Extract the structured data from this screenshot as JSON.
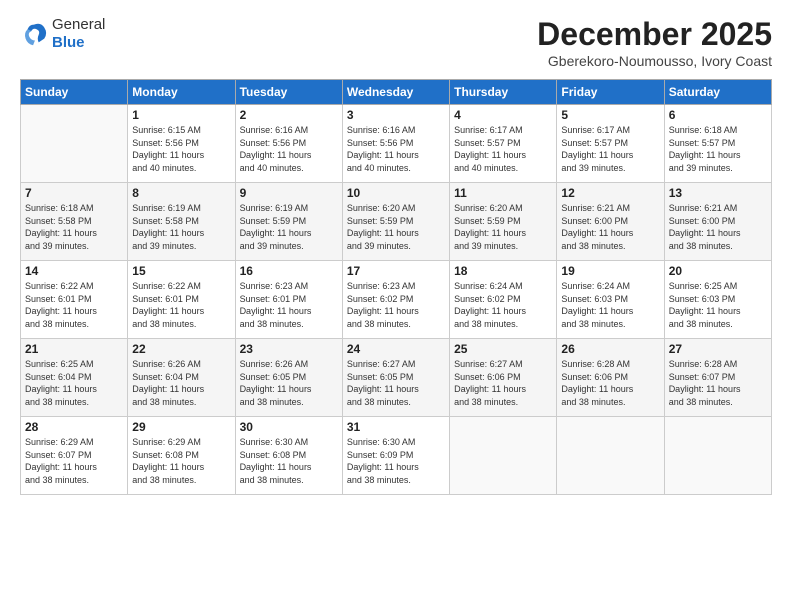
{
  "header": {
    "logo_general": "General",
    "logo_blue": "Blue",
    "month_year": "December 2025",
    "location": "Gberekoro-Noumousso, Ivory Coast"
  },
  "days_of_week": [
    "Sunday",
    "Monday",
    "Tuesday",
    "Wednesday",
    "Thursday",
    "Friday",
    "Saturday"
  ],
  "weeks": [
    [
      {
        "day": "",
        "info": ""
      },
      {
        "day": "1",
        "info": "Sunrise: 6:15 AM\nSunset: 5:56 PM\nDaylight: 11 hours\nand 40 minutes."
      },
      {
        "day": "2",
        "info": "Sunrise: 6:16 AM\nSunset: 5:56 PM\nDaylight: 11 hours\nand 40 minutes."
      },
      {
        "day": "3",
        "info": "Sunrise: 6:16 AM\nSunset: 5:56 PM\nDaylight: 11 hours\nand 40 minutes."
      },
      {
        "day": "4",
        "info": "Sunrise: 6:17 AM\nSunset: 5:57 PM\nDaylight: 11 hours\nand 40 minutes."
      },
      {
        "day": "5",
        "info": "Sunrise: 6:17 AM\nSunset: 5:57 PM\nDaylight: 11 hours\nand 39 minutes."
      },
      {
        "day": "6",
        "info": "Sunrise: 6:18 AM\nSunset: 5:57 PM\nDaylight: 11 hours\nand 39 minutes."
      }
    ],
    [
      {
        "day": "7",
        "info": "Sunrise: 6:18 AM\nSunset: 5:58 PM\nDaylight: 11 hours\nand 39 minutes."
      },
      {
        "day": "8",
        "info": "Sunrise: 6:19 AM\nSunset: 5:58 PM\nDaylight: 11 hours\nand 39 minutes."
      },
      {
        "day": "9",
        "info": "Sunrise: 6:19 AM\nSunset: 5:59 PM\nDaylight: 11 hours\nand 39 minutes."
      },
      {
        "day": "10",
        "info": "Sunrise: 6:20 AM\nSunset: 5:59 PM\nDaylight: 11 hours\nand 39 minutes."
      },
      {
        "day": "11",
        "info": "Sunrise: 6:20 AM\nSunset: 5:59 PM\nDaylight: 11 hours\nand 39 minutes."
      },
      {
        "day": "12",
        "info": "Sunrise: 6:21 AM\nSunset: 6:00 PM\nDaylight: 11 hours\nand 38 minutes."
      },
      {
        "day": "13",
        "info": "Sunrise: 6:21 AM\nSunset: 6:00 PM\nDaylight: 11 hours\nand 38 minutes."
      }
    ],
    [
      {
        "day": "14",
        "info": "Sunrise: 6:22 AM\nSunset: 6:01 PM\nDaylight: 11 hours\nand 38 minutes."
      },
      {
        "day": "15",
        "info": "Sunrise: 6:22 AM\nSunset: 6:01 PM\nDaylight: 11 hours\nand 38 minutes."
      },
      {
        "day": "16",
        "info": "Sunrise: 6:23 AM\nSunset: 6:01 PM\nDaylight: 11 hours\nand 38 minutes."
      },
      {
        "day": "17",
        "info": "Sunrise: 6:23 AM\nSunset: 6:02 PM\nDaylight: 11 hours\nand 38 minutes."
      },
      {
        "day": "18",
        "info": "Sunrise: 6:24 AM\nSunset: 6:02 PM\nDaylight: 11 hours\nand 38 minutes."
      },
      {
        "day": "19",
        "info": "Sunrise: 6:24 AM\nSunset: 6:03 PM\nDaylight: 11 hours\nand 38 minutes."
      },
      {
        "day": "20",
        "info": "Sunrise: 6:25 AM\nSunset: 6:03 PM\nDaylight: 11 hours\nand 38 minutes."
      }
    ],
    [
      {
        "day": "21",
        "info": "Sunrise: 6:25 AM\nSunset: 6:04 PM\nDaylight: 11 hours\nand 38 minutes."
      },
      {
        "day": "22",
        "info": "Sunrise: 6:26 AM\nSunset: 6:04 PM\nDaylight: 11 hours\nand 38 minutes."
      },
      {
        "day": "23",
        "info": "Sunrise: 6:26 AM\nSunset: 6:05 PM\nDaylight: 11 hours\nand 38 minutes."
      },
      {
        "day": "24",
        "info": "Sunrise: 6:27 AM\nSunset: 6:05 PM\nDaylight: 11 hours\nand 38 minutes."
      },
      {
        "day": "25",
        "info": "Sunrise: 6:27 AM\nSunset: 6:06 PM\nDaylight: 11 hours\nand 38 minutes."
      },
      {
        "day": "26",
        "info": "Sunrise: 6:28 AM\nSunset: 6:06 PM\nDaylight: 11 hours\nand 38 minutes."
      },
      {
        "day": "27",
        "info": "Sunrise: 6:28 AM\nSunset: 6:07 PM\nDaylight: 11 hours\nand 38 minutes."
      }
    ],
    [
      {
        "day": "28",
        "info": "Sunrise: 6:29 AM\nSunset: 6:07 PM\nDaylight: 11 hours\nand 38 minutes."
      },
      {
        "day": "29",
        "info": "Sunrise: 6:29 AM\nSunset: 6:08 PM\nDaylight: 11 hours\nand 38 minutes."
      },
      {
        "day": "30",
        "info": "Sunrise: 6:30 AM\nSunset: 6:08 PM\nDaylight: 11 hours\nand 38 minutes."
      },
      {
        "day": "31",
        "info": "Sunrise: 6:30 AM\nSunset: 6:09 PM\nDaylight: 11 hours\nand 38 minutes."
      },
      {
        "day": "",
        "info": ""
      },
      {
        "day": "",
        "info": ""
      },
      {
        "day": "",
        "info": ""
      }
    ]
  ]
}
